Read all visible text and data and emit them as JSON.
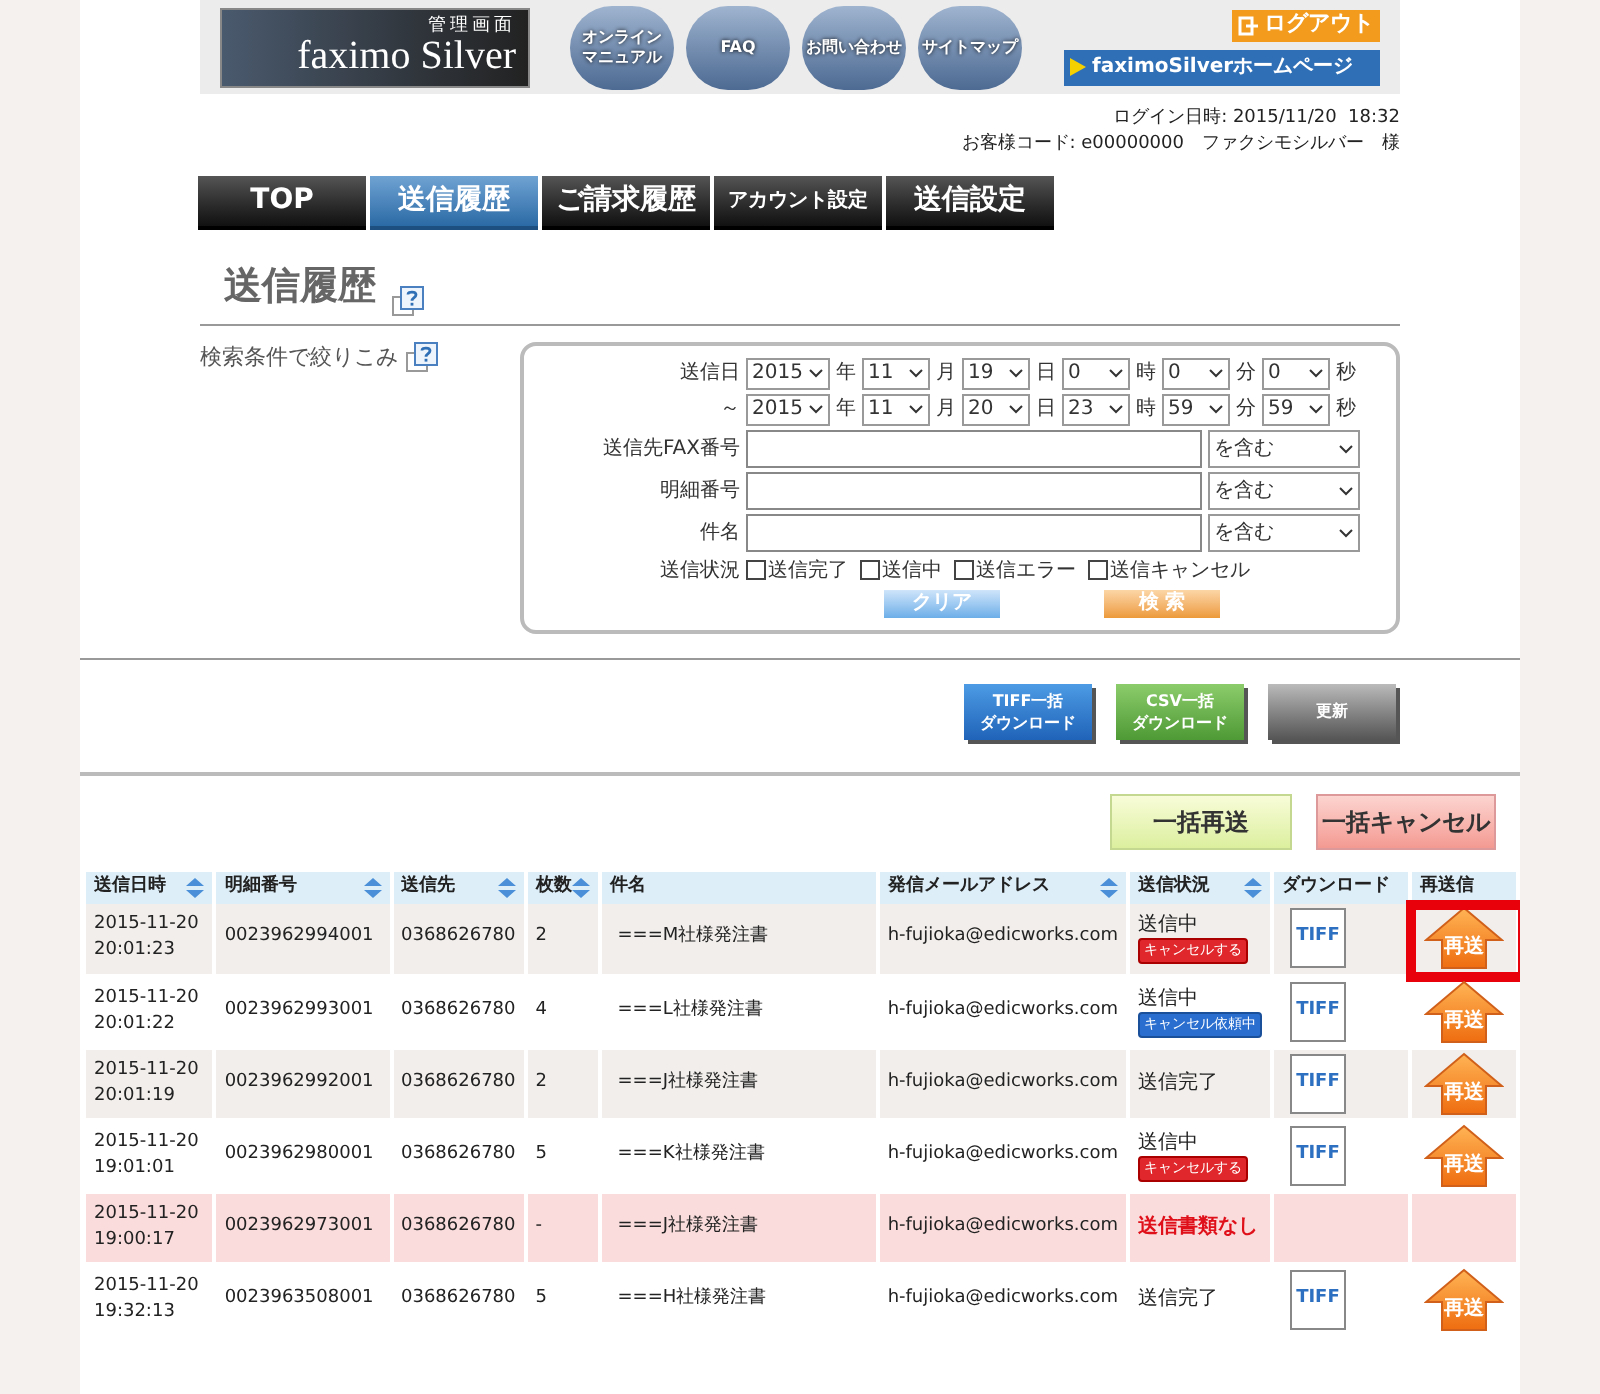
{
  "header": {
    "logo_label": "管理画面",
    "logo_text": "faximo Silver",
    "nav_circles": [
      {
        "lines": [
          "オンライン",
          "マニュアル"
        ]
      },
      {
        "lines": [
          "FAQ"
        ]
      },
      {
        "lines": [
          "お問い合わせ"
        ]
      },
      {
        "lines": [
          "サイトマップ"
        ]
      }
    ],
    "logout": "ログアウト",
    "home_link": "faximoSilverホームページ"
  },
  "login_info": {
    "login_time": "ログイン日時: 2015/11/20  18:32",
    "customer": "お客様コード: e00000000　ファクシモシルバー　様"
  },
  "tabs": [
    {
      "label": "TOP",
      "selected": false
    },
    {
      "label": "送信履歴",
      "selected": true
    },
    {
      "label": "ご請求履歴",
      "selected": false
    },
    {
      "label": "アカウント設定",
      "selected": false
    },
    {
      "label": "送信設定",
      "selected": false
    }
  ],
  "page_title": "送信履歴",
  "filter": {
    "label": "検索条件で絞りこみ",
    "date_rows": [
      {
        "label": "送信日",
        "parts": [
          {
            "value": "2015",
            "unit": "年"
          },
          {
            "value": "11",
            "unit": "月"
          },
          {
            "value": "19",
            "unit": "日"
          },
          {
            "value": "0",
            "unit": "時"
          },
          {
            "value": "0",
            "unit": "分"
          },
          {
            "value": "0",
            "unit": "秒"
          }
        ]
      },
      {
        "label": "～",
        "parts": [
          {
            "value": "2015",
            "unit": "年"
          },
          {
            "value": "11",
            "unit": "月"
          },
          {
            "value": "20",
            "unit": "日"
          },
          {
            "value": "23",
            "unit": "時"
          },
          {
            "value": "59",
            "unit": "分"
          },
          {
            "value": "59",
            "unit": "秒"
          }
        ]
      }
    ],
    "text_fields": [
      {
        "label": "送信先FAX番号",
        "match": "を含む"
      },
      {
        "label": "明細番号",
        "match": "を含む"
      },
      {
        "label": "件名",
        "match": "を含む"
      }
    ],
    "status_label": "送信状況",
    "status_options": [
      {
        "label": "送信完了",
        "checked": false
      },
      {
        "label": "送信中",
        "checked": false
      },
      {
        "label": "送信エラー",
        "checked": false
      },
      {
        "label": "送信キャンセル",
        "checked": false
      }
    ],
    "clear_button": "クリア",
    "search_button": "検 索"
  },
  "download_buttons": [
    {
      "lines": [
        "TIFF一括",
        "ダウンロード"
      ],
      "kind": "tiff"
    },
    {
      "lines": [
        "CSV一括",
        "ダウンロード"
      ],
      "kind": "csv"
    },
    {
      "lines": [
        "更新"
      ],
      "kind": "refresh"
    }
  ],
  "bulk_buttons": [
    {
      "label": "一括再送",
      "kind": "resend"
    },
    {
      "label": "一括キャンセル",
      "kind": "cancel"
    }
  ],
  "table": {
    "columns": [
      {
        "label": "送信日時",
        "sortable": true
      },
      {
        "label": "明細番号",
        "sortable": true
      },
      {
        "label": "送信先",
        "sortable": true
      },
      {
        "label": "枚数",
        "sortable": true
      },
      {
        "label": "件名",
        "sortable": false
      },
      {
        "label": "発信メールアドレス",
        "sortable": true
      },
      {
        "label": "送信状況",
        "sortable": true
      },
      {
        "label": "ダウンロード",
        "sortable": false
      },
      {
        "label": "再送信",
        "sortable": false
      }
    ],
    "rows": [
      {
        "date": "2015-11-20",
        "time": "20:01:23",
        "detail_no": "0023962994001",
        "to": "0368626780",
        "pages": "2",
        "subject": "===M社様発注書",
        "email": "h-fujioka@edicworks.com",
        "status": "送信中",
        "error": false,
        "badge": {
          "label": "キャンセルする",
          "kind": "cancel"
        },
        "download": "TIFF",
        "resend": "再送"
      },
      {
        "date": "2015-11-20",
        "time": "20:01:22",
        "detail_no": "0023962993001",
        "to": "0368626780",
        "pages": "4",
        "subject": "===L社様発注書",
        "email": "h-fujioka@edicworks.com",
        "status": "送信中",
        "error": false,
        "badge": {
          "label": "キャンセル依頼中",
          "kind": "requested"
        },
        "download": "TIFF",
        "resend": "再送"
      },
      {
        "date": "2015-11-20",
        "time": "20:01:19",
        "detail_no": "0023962992001",
        "to": "0368626780",
        "pages": "2",
        "subject": "===J社様発注書",
        "email": "h-fujioka@edicworks.com",
        "status": "送信完了",
        "error": false,
        "download": "TIFF",
        "resend": "再送"
      },
      {
        "date": "2015-11-20",
        "time": "19:01:01",
        "detail_no": "0023962980001",
        "to": "0368626780",
        "pages": "5",
        "subject": "===K社様発注書",
        "email": "h-fujioka@edicworks.com",
        "status": "送信中",
        "error": false,
        "badge": {
          "label": "キャンセルする",
          "kind": "cancel"
        },
        "download": "TIFF",
        "resend": "再送"
      },
      {
        "date": "2015-11-20",
        "time": "19:00:17",
        "detail_no": "0023962973001",
        "to": "0368626780",
        "pages": "-",
        "subject": "===J社様発注書",
        "email": "h-fujioka@edicworks.com",
        "status": "送信書類なし",
        "error": true
      },
      {
        "date": "2015-11-20",
        "time": "19:32:13",
        "detail_no": "0023963508001",
        "to": "0368626780",
        "pages": "5",
        "subject": "===H社様発注書",
        "email": "h-fujioka@edicworks.com",
        "status": "送信完了",
        "error": false,
        "download": "TIFF",
        "resend": "再送"
      }
    ]
  }
}
